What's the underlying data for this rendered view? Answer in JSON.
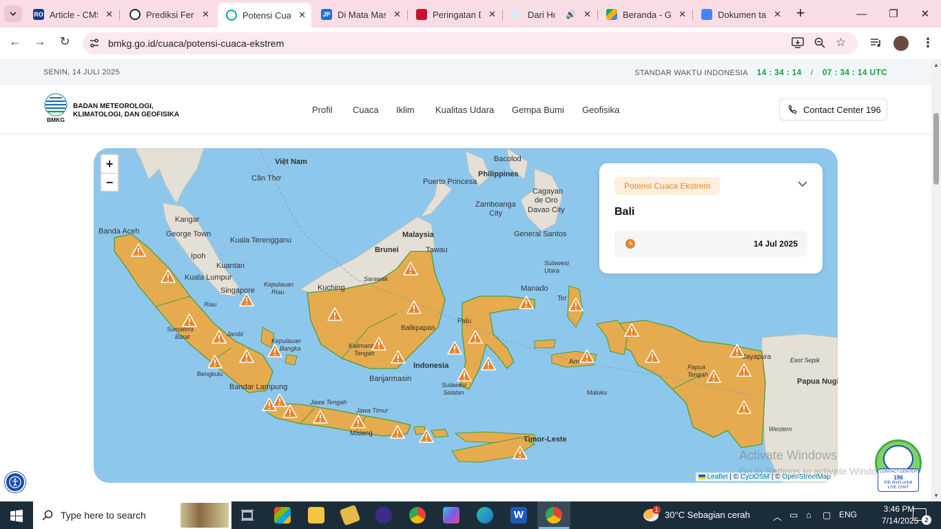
{
  "browser": {
    "tabs": [
      {
        "title": "Article - CMS",
        "icon_color": "#1b3a8c",
        "icon_text": "RO"
      },
      {
        "title": "Prediksi Fenomena",
        "icon_color": "#222222",
        "icon_text": ""
      },
      {
        "title": "Potensi Cuaca",
        "icon_color": "#1a9e9a",
        "icon_text": ""
      },
      {
        "title": "Di Mata Masyarakat",
        "icon_color": "#1f73c8",
        "icon_text": "JP"
      },
      {
        "title": "Peringatan Dini",
        "icon_color": "#c4122f",
        "icon_text": ""
      },
      {
        "title": "Dari Hong",
        "icon_color": "#6f8fb5",
        "icon_text": ""
      },
      {
        "title": "Beranda - Google Drive",
        "icon_color": "#f6b400",
        "icon_text": ""
      },
      {
        "title": "Dokumen tanpa judul",
        "icon_color": "#4285f4",
        "icon_text": ""
      }
    ],
    "url": "bmkg.go.id/cuaca/potensi-cuaca-ekstrem"
  },
  "topbar": {
    "date": "SENIN, 14 JULI 2025",
    "standard_label": "STANDAR WAKTU INDONESIA",
    "local_time": "14 : 34 : 14",
    "separator": "/",
    "utc_time": "07 : 34 : 14 UTC"
  },
  "header": {
    "logo_text": "BMKG",
    "brand_line1": "BADAN METEOROLOGI,",
    "brand_line2": "KLIMATOLOGI, DAN GEOFISIKA",
    "menu": [
      "Profil",
      "Cuaca",
      "Iklim",
      "Kualitas Udara",
      "Gempa Bumi",
      "Geofisika"
    ],
    "contact": "Contact Center 196"
  },
  "map": {
    "zoom_in": "+",
    "zoom_out": "−",
    "info": {
      "badge": "Potensi Cuaca Ekstrem",
      "region": "Bali",
      "date": "14 Jul 2025"
    },
    "attribution": {
      "leaflet": "Leaflet",
      "sep1": " | © ",
      "cyclosm": "CyclOSM",
      "sep2": " | © ",
      "osm": "OpenStreetMap"
    },
    "labels": {
      "vietnam": "Việt Nam",
      "cantho": "Cần Thơ",
      "philippines": "Philippines",
      "bacolod": "Bacolod",
      "puerto": "Puerto Princesa",
      "zamboanga": "Zamboanga",
      "zamboanga2": "City",
      "cagayan": "Cagayan",
      "cagayan2": "de Oro",
      "davao": "Davao City",
      "gensan": "General Santos",
      "kangar": "Kangar",
      "georgetown": "George Town",
      "ipoh": "Ipoh",
      "kualaterengganu": "Kuala Terengganu",
      "kuantan": "Kuantan",
      "kualalumpur": "Kuala Lumpur",
      "bandaaceh": "Banda Aceh",
      "malaysia": "Malaysia",
      "brunei": "Brunei",
      "tawau": "Tawau",
      "singapore": "Singapore",
      "kuching": "Kuching",
      "sarawak": "Sarawak",
      "manado": "Manado",
      "indonesia": "Indonesia",
      "banjarmasin": "Banjarmasin",
      "bandarlampung": "Bandar Lampung",
      "bengkulu": "Bengkulu",
      "jawatengah": "Jawa Tengah",
      "jawatimur": "Jawa Timur",
      "malang": "Malang",
      "timorleste": "Timor-Leste",
      "maluku": "Maluku",
      "papuanugini": "Papua Nugini",
      "eastsepik": "East Sepik",
      "western": "Western",
      "jayapura": "Jayapura",
      "sulawesiselatan": "Sulawesi",
      "sulawesiselatan2": "Selatan",
      "kalimantantengah": "Kalimantan",
      "kalimantantengah2": "Tengah",
      "baliklapan": "Balikpapan",
      "palu": "Palu",
      "ambon": "Am",
      "ternate": "Ter",
      "sumaterabarat": "Sumatera",
      "sumaterabarat2": "Barat",
      "jambi": "Jambi",
      "riau": "Riau",
      "kepriau": "Kepulauan",
      "kepriau2": "Riau",
      "kepbangka": "Kepulauan",
      "kepbangka2": "Bangka",
      "papuatengah": "Papua",
      "papuatengah2": "Tengah",
      "sulawesiutara": "Sulawesi",
      "sulawesiutara2": "Utara"
    }
  },
  "watermark": {
    "line1": "Activate Windows",
    "line2": "Go to Settings to activate Windows."
  },
  "mascot": {
    "line1": "CONTACT CENTER",
    "line2": "196",
    "line3": "Klik disini untuk",
    "line4": "LIVE CHAT"
  },
  "taskbar": {
    "search_placeholder": "Type here to search",
    "weather": "30°C  Sebagian cerah",
    "weather_badge": "1",
    "lang": "ENG",
    "time": "3:46 PM",
    "date": "7/14/2025",
    "notif": "2"
  },
  "colors": {
    "land": "#e6ab4f",
    "sea": "#8ec7ec",
    "neighbor_land": "#e4e0d6",
    "warning": "#e8862a",
    "accent_green": "#12a33b"
  }
}
